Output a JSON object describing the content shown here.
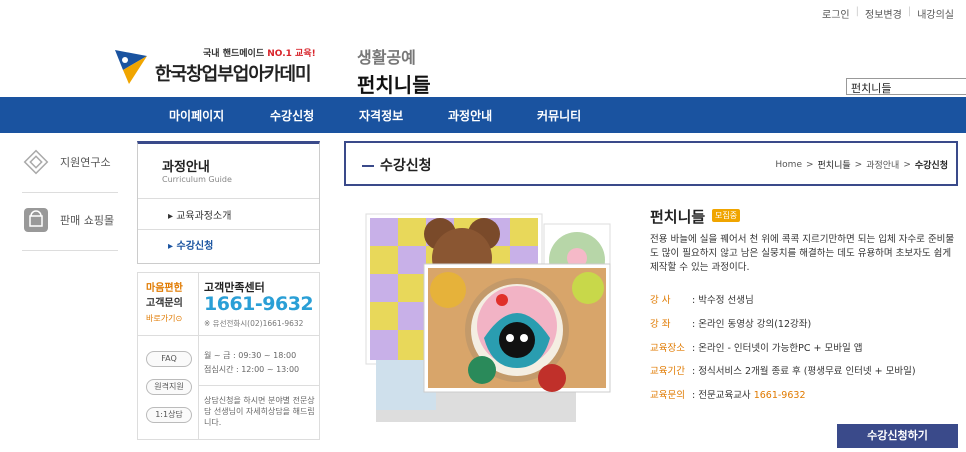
{
  "top_links": [
    "로그인",
    "정보변경",
    "내강의실"
  ],
  "logo": {
    "tag_prefix": "국내 핸드메이드 ",
    "tag_highlight": "NO.1 교육!",
    "name": "한국창업부업아카데미"
  },
  "category": {
    "sub": "생활공예",
    "title": "펀치니들"
  },
  "search": {
    "value": "펀치니들"
  },
  "nav": [
    "마이페이지",
    "수강신청",
    "자격정보",
    "과정안내",
    "커뮤니티"
  ],
  "left_rail": [
    {
      "label": "지원연구소",
      "icon": "diamond-icon"
    },
    {
      "label": "판매 쇼핑몰",
      "icon": "shopping-bag-icon"
    }
  ],
  "sidebox": {
    "title": "과정안내",
    "subtitle": "Curriculum Guide",
    "links": [
      "▸ 교육과정소개",
      "▸ 수강신청"
    ]
  },
  "customer_center": {
    "left_line1": "마음편한",
    "left_line2": "고객문의",
    "left_line3": "바로가기⊙",
    "title": "고객만족센터",
    "phone": "1661-9632",
    "alt_phone": "※ 유선전화시(02)1661-9632",
    "buttons": [
      "FAQ",
      "원격지원",
      "1:1상담"
    ],
    "hours_line1": "월 ~ 금 : 09:30 ~ 18:00",
    "hours_line2": "점심시간 : 12:00 ~ 13:00",
    "note": "상담신청을 하시면 분야별 전문상담 선생님이 자세히상담을 해드립니다."
  },
  "header": {
    "title": "수강신청",
    "breadcrumb": [
      "Home",
      ">",
      "펀치니들",
      ">",
      "과정안내",
      ">",
      "수강신청"
    ]
  },
  "product": {
    "title": "펀치니들",
    "badge": "모집중",
    "description": "전용 바늘에 실을 꿰어서 천 위에 콕콕 지르기만하면 되는 입체 자수로 준비물도 많이 필요하지 않고 남은 실뭉치를 해결하는 데도 유용하며 초보자도 쉽게 제작할 수 있는 과정이다.",
    "info": [
      {
        "k": "강     사",
        "v": "박수정 선생님"
      },
      {
        "k": "강     좌",
        "v": "온라인 동영상 강의(12강좌)"
      },
      {
        "k": "교육장소",
        "v": "온라인 - 인터넷이 가능한PC + 모바일 앱"
      },
      {
        "k": "교육기간",
        "v": "정식서비스 2개월 종료 후 (평생무료 인터넷 + 모바일)"
      },
      {
        "k": "교육문의",
        "v": "전문교육교사 ",
        "phone": "1661-9632"
      }
    ],
    "cta": "수강신청하기"
  },
  "colors": {
    "nav_blue": "#1a53a0",
    "accent_navy": "#3a4a8a",
    "orange": "#e07a00",
    "phone_blue": "#2a9fd6"
  }
}
